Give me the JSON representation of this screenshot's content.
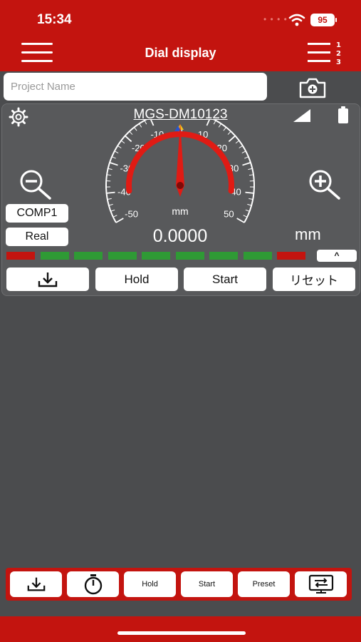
{
  "status": {
    "time": "15:34",
    "battery": "95"
  },
  "header": {
    "title": "Dial display"
  },
  "project": {
    "placeholder": "Project Name",
    "value": ""
  },
  "device": {
    "name": "MGS-DM10123",
    "comp_label": "COMP1",
    "mode_label": "Real",
    "value": "0.0000",
    "unit": "mm",
    "dial_unit": "mm"
  },
  "dial": {
    "range": [
      -50,
      50
    ],
    "needle_value": 0,
    "tick_labels": [
      "-50",
      "-40",
      "-30",
      "-20",
      "-10",
      "0",
      "10",
      "20",
      "30",
      "40",
      "50"
    ],
    "arc_color": "#e01b14"
  },
  "tolerance_bar": {
    "segments": [
      "red",
      "green",
      "green",
      "green",
      "green",
      "green",
      "green",
      "green",
      "red"
    ],
    "collapse_label": "^"
  },
  "actions": {
    "download_icon": "download-icon",
    "hold_label": "Hold",
    "start_label": "Start",
    "reset_label": "リセット"
  },
  "bottom_toolbar": {
    "download_icon": "download-icon",
    "timer_icon": "stopwatch-icon",
    "hold_label": "Hold",
    "start_label": "Start",
    "preset_label": "Preset",
    "display_icon": "monitor-swap-icon"
  },
  "colors": {
    "brand_red": "#c3140f",
    "background": "#4b4c4e",
    "ok_green": "#2f9a35",
    "ng_red": "#c3140f"
  }
}
